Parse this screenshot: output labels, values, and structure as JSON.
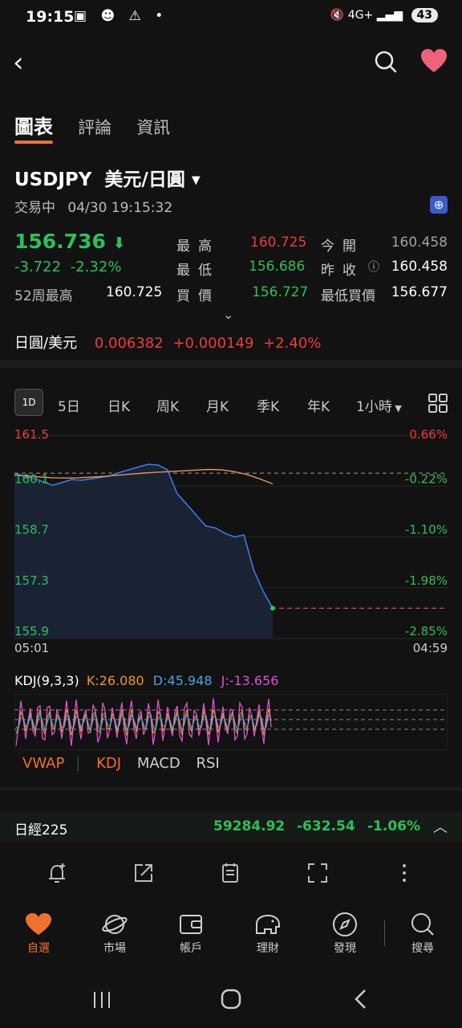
{
  "status_bar": {
    "time": "19:15",
    "battery": "43",
    "network": "4G+"
  },
  "tabs": [
    {
      "label": "圖表",
      "active": true
    },
    {
      "label": "評論",
      "active": false
    },
    {
      "label": "資訊",
      "active": false
    }
  ],
  "quote": {
    "symbol": "USDJPY",
    "name": "美元/日圓",
    "trade_status": "交易中",
    "datetime": "04/30 19:15:32",
    "price": "156.736",
    "change": "-3.722",
    "change_pct": "-2.32%",
    "week52_label": "52周最高",
    "week52_value": "160.725",
    "high_label": "最高",
    "high": "160.725",
    "open_label": "今開",
    "open": "160.458",
    "low_label": "最低",
    "low": "156.686",
    "prev_close_label": "昨收",
    "prev_close": "160.458",
    "bid_label": "買價",
    "bid": "156.727",
    "low_bid_label": "最低買價",
    "low_bid": "156.677"
  },
  "cross_rate": {
    "label": "日圓/美元",
    "value": "0.006382",
    "change": "+0.000149",
    "change_pct": "+2.40%"
  },
  "periods": {
    "selected": "1D",
    "items": [
      "5日",
      "日K",
      "周K",
      "月K",
      "季K",
      "年K"
    ],
    "interval": "1小時"
  },
  "chart_data": {
    "type": "line",
    "y_labels": [
      "161.5",
      "160.1",
      "158.7",
      "157.3",
      "155.9"
    ],
    "pct_labels": [
      "0.66%",
      "-0.22%",
      "-1.10%",
      "-1.98%",
      "-2.85%"
    ],
    "x_labels": [
      "05:01",
      "04:59"
    ],
    "ylim": [
      155.9,
      161.5
    ],
    "prev_close": 160.458,
    "last": 156.736,
    "series": [
      {
        "values": [
          160.45,
          160.38,
          160.31,
          160.22,
          160.12,
          160.2,
          160.28,
          160.26,
          160.3,
          160.34,
          160.38,
          160.48,
          160.55,
          160.63,
          160.7,
          160.68,
          160.55,
          159.9,
          159.6,
          159.3,
          159.0,
          158.95,
          158.8,
          158.7,
          158.75,
          157.8,
          157.2,
          156.736
        ]
      },
      {
        "values": [
          160.4,
          160.38,
          160.35,
          160.33,
          160.32,
          160.33,
          160.35,
          160.37,
          160.4,
          160.43,
          160.46,
          160.48,
          160.5,
          160.52,
          160.54,
          160.56,
          160.55,
          160.5,
          160.42,
          160.3,
          160.16
        ]
      }
    ]
  },
  "kdj": {
    "label": "KDJ(9,3,3)",
    "k": "K:26.080",
    "d": "D:45.948",
    "j": "J:-13.656",
    "colors": {
      "k": "#f0922e",
      "d": "#4aa3e0",
      "j": "#e04fd0"
    }
  },
  "indicator_tabs": [
    "VWAP",
    "KDJ",
    "MACD",
    "RSI"
  ],
  "ticker": {
    "name": "日經225",
    "value": "59284.92",
    "change": "-632.54",
    "change_pct": "-1.06%"
  },
  "toolbar": [
    "alarm-icon",
    "share-icon",
    "notes-icon",
    "fullscreen-icon",
    "more-icon"
  ],
  "bottom_nav": [
    {
      "label": "自選",
      "icon": "heart-icon",
      "active": true
    },
    {
      "label": "市場",
      "icon": "planet-icon",
      "active": false
    },
    {
      "label": "帳戶",
      "icon": "wallet-icon",
      "active": false
    },
    {
      "label": "理財",
      "icon": "piggy-icon",
      "active": false
    },
    {
      "label": "發現",
      "icon": "compass-icon",
      "active": false
    },
    {
      "label": "搜尋",
      "icon": "search-icon",
      "active": false
    }
  ],
  "colors": {
    "up": "#ef3b3b",
    "down": "#2fbf5a",
    "accent": "#f07030",
    "line": "#3a7ae8",
    "avg": "#e8915a"
  }
}
